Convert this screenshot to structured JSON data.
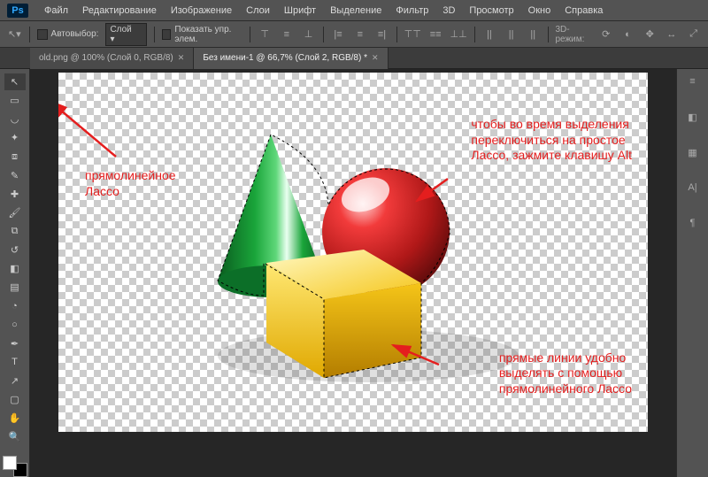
{
  "brand": "Ps",
  "menu": [
    "Файл",
    "Редактирование",
    "Изображение",
    "Слои",
    "Шрифт",
    "Выделение",
    "Фильтр",
    "3D",
    "Просмотр",
    "Окно",
    "Справка"
  ],
  "options": {
    "autoselect_label": "Автовыбор:",
    "autoselect_value": "Слой",
    "showctrls_label": "Показать упр. элем.",
    "mode_label": "3D-режим:"
  },
  "tabs": [
    {
      "label": "old.png @ 100% (Слой 0, RGB/8)",
      "active": false
    },
    {
      "label": "Без имени-1 @ 66,7% (Слой 2, RGB/8) *",
      "active": true
    }
  ],
  "tools": [
    {
      "name": "move",
      "glyph": "↖"
    },
    {
      "name": "marquee",
      "glyph": "▭"
    },
    {
      "name": "lasso",
      "glyph": "◡"
    },
    {
      "name": "magic-wand",
      "glyph": "✦"
    },
    {
      "name": "crop",
      "glyph": "⧈"
    },
    {
      "name": "eyedropper",
      "glyph": "✎"
    },
    {
      "name": "healing",
      "glyph": "✚"
    },
    {
      "name": "brush",
      "glyph": "🖌"
    },
    {
      "name": "stamp",
      "glyph": "⧉"
    },
    {
      "name": "history-brush",
      "glyph": "↺"
    },
    {
      "name": "eraser",
      "glyph": "◧"
    },
    {
      "name": "gradient",
      "glyph": "▤"
    },
    {
      "name": "blur",
      "glyph": "◔"
    },
    {
      "name": "dodge",
      "glyph": "○"
    },
    {
      "name": "pen",
      "glyph": "✒"
    },
    {
      "name": "type",
      "glyph": "T"
    },
    {
      "name": "path-select",
      "glyph": "↗"
    },
    {
      "name": "shape",
      "glyph": "▢"
    },
    {
      "name": "hand",
      "glyph": "✋"
    },
    {
      "name": "zoom",
      "glyph": "🔍"
    }
  ],
  "right_tools": [
    {
      "name": "history",
      "glyph": "≡"
    },
    {
      "name": "color",
      "glyph": "◧"
    },
    {
      "name": "swatches",
      "glyph": "▦"
    },
    {
      "name": "text",
      "glyph": "A|"
    },
    {
      "name": "paragraph",
      "glyph": "¶"
    }
  ],
  "annotations": {
    "left": "прямолинейное\nЛассо",
    "topright": "чтобы во время выделения\nпереключиться на простое\nЛассо, зажмите клавишу Alt",
    "bottomright": "прямые линии удобно\nвыделять с помощью\nпрямолинейного Лассо"
  }
}
